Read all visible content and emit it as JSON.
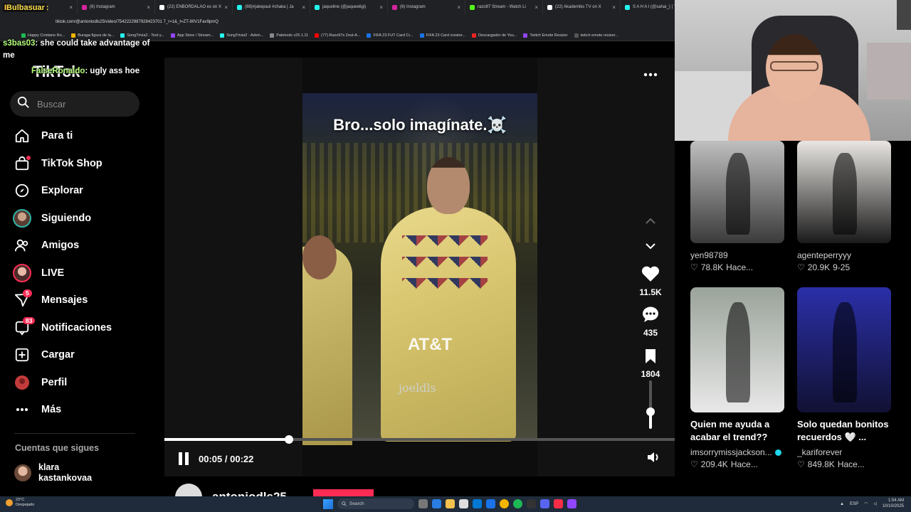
{
  "browser": {
    "tabs": [
      {
        "label": "(138) YouTube",
        "color": "#ff0000"
      },
      {
        "label": "(6) Instagram",
        "color": "#d6249f"
      },
      {
        "label": "(22) ENBORDALAO es on X",
        "color": "#ffffff"
      },
      {
        "label": "(88)#jakepaul #chaka | Ja",
        "color": "#25f4ee"
      },
      {
        "label": "jaqueline (@jaqueeligi)",
        "color": "#25f4ee"
      },
      {
        "label": "(6) Instagram",
        "color": "#d6249f"
      },
      {
        "label": "razo97 Stream - Watch Li",
        "color": "#53fc18"
      },
      {
        "label": "(22) Akademiks TV on X",
        "color": "#ffffff"
      },
      {
        "label": "S A H A I (@sahai_) | TikTok",
        "color": "#25f4ee"
      }
    ],
    "url": "tiktok.com/@antoniodls25/video/7542222987928423701 7_r=1&_t=ZT-90V1Fav9pmQ",
    "bookmarks": [
      "Happy Cristiano Ro...",
      "Buraga figura de la...",
      "SongTrivia2 - Test y...",
      "App Store / Stream...",
      "SongTrivia2 - Advin...",
      "Paletools v25.1.11",
      "(77) Razo97s Zest-A...",
      "FIFA 23 FUT Card Cr...",
      "FIFA 23 Card creator...",
      "Descargador de You...",
      "Twitch Emote Resizer",
      "twitch emote resizer..."
    ]
  },
  "chat": {
    "top_user": "IBulbasuar",
    "messages": [
      {
        "user": "s3bas03",
        "text": ": she could take advantage of me"
      },
      {
        "user": "FalseRonaldo",
        "text": ": ugly ass hoe"
      }
    ]
  },
  "sidebar": {
    "logo": "TikTok",
    "search_placeholder": "Buscar",
    "nav": [
      {
        "label": "Para ti",
        "icon": "home-icon"
      },
      {
        "label": "TikTok Shop",
        "icon": "shop-icon"
      },
      {
        "label": "Explorar",
        "icon": "compass-icon"
      },
      {
        "label": "Siguiendo",
        "icon": "following-avatar-icon"
      },
      {
        "label": "Amigos",
        "icon": "friends-icon"
      },
      {
        "label": "LIVE",
        "icon": "live-avatar-icon"
      },
      {
        "label": "Mensajes",
        "icon": "messages-icon",
        "badge": "5"
      },
      {
        "label": "Notificaciones",
        "icon": "notifications-icon",
        "badge": "83"
      },
      {
        "label": "Cargar",
        "icon": "upload-icon"
      },
      {
        "label": "Perfil",
        "icon": "profile-icon"
      },
      {
        "label": "Más",
        "icon": "more-icon"
      }
    ],
    "following_title": "Cuentas que sigues",
    "following": [
      {
        "name": "klara\nkastankovaa"
      }
    ]
  },
  "video": {
    "caption": "Bro...solo imagínate.☠️",
    "watermark": "joeldls",
    "jersey_text": "AT&T",
    "time_current": "00:05",
    "time_total": "00:22",
    "progress": 0.2439,
    "volume": 0.35,
    "author": "antoniodls25"
  },
  "actions": {
    "likes": "11.5K",
    "comments": "435",
    "saves": "1804"
  },
  "recommended": [
    {
      "user": "yen98789",
      "likes": "78.8K",
      "time": "Hace...",
      "title": "",
      "palette": [
        "#bfbfbf",
        "#3a3a3a"
      ]
    },
    {
      "user": "agenteperryyy",
      "likes": "20.9K",
      "time": "9-25",
      "title": "",
      "palette": [
        "#e9e6e2",
        "#1a1a1a"
      ]
    },
    {
      "user": "imsorrymissjackson...",
      "likes": "209.4K",
      "time": "Hace...",
      "title": "Quien me ayuda a acabar el trend??",
      "verified": true,
      "palette": [
        "#9aa39a",
        "#e8e8e8"
      ]
    },
    {
      "user": "_kariforever",
      "likes": "849.8K",
      "time": "Hace...",
      "title": "Solo quedan bonitos recuerdos 🤍 ...",
      "palette": [
        "#2b2fa8",
        "#111133"
      ]
    }
  ],
  "taskbar": {
    "weather_temp": "23°C",
    "weather_desc": "Despejado",
    "search_label": "Search",
    "lang": "ESP",
    "time": "1:54 AM",
    "date": "10/10/2025"
  }
}
